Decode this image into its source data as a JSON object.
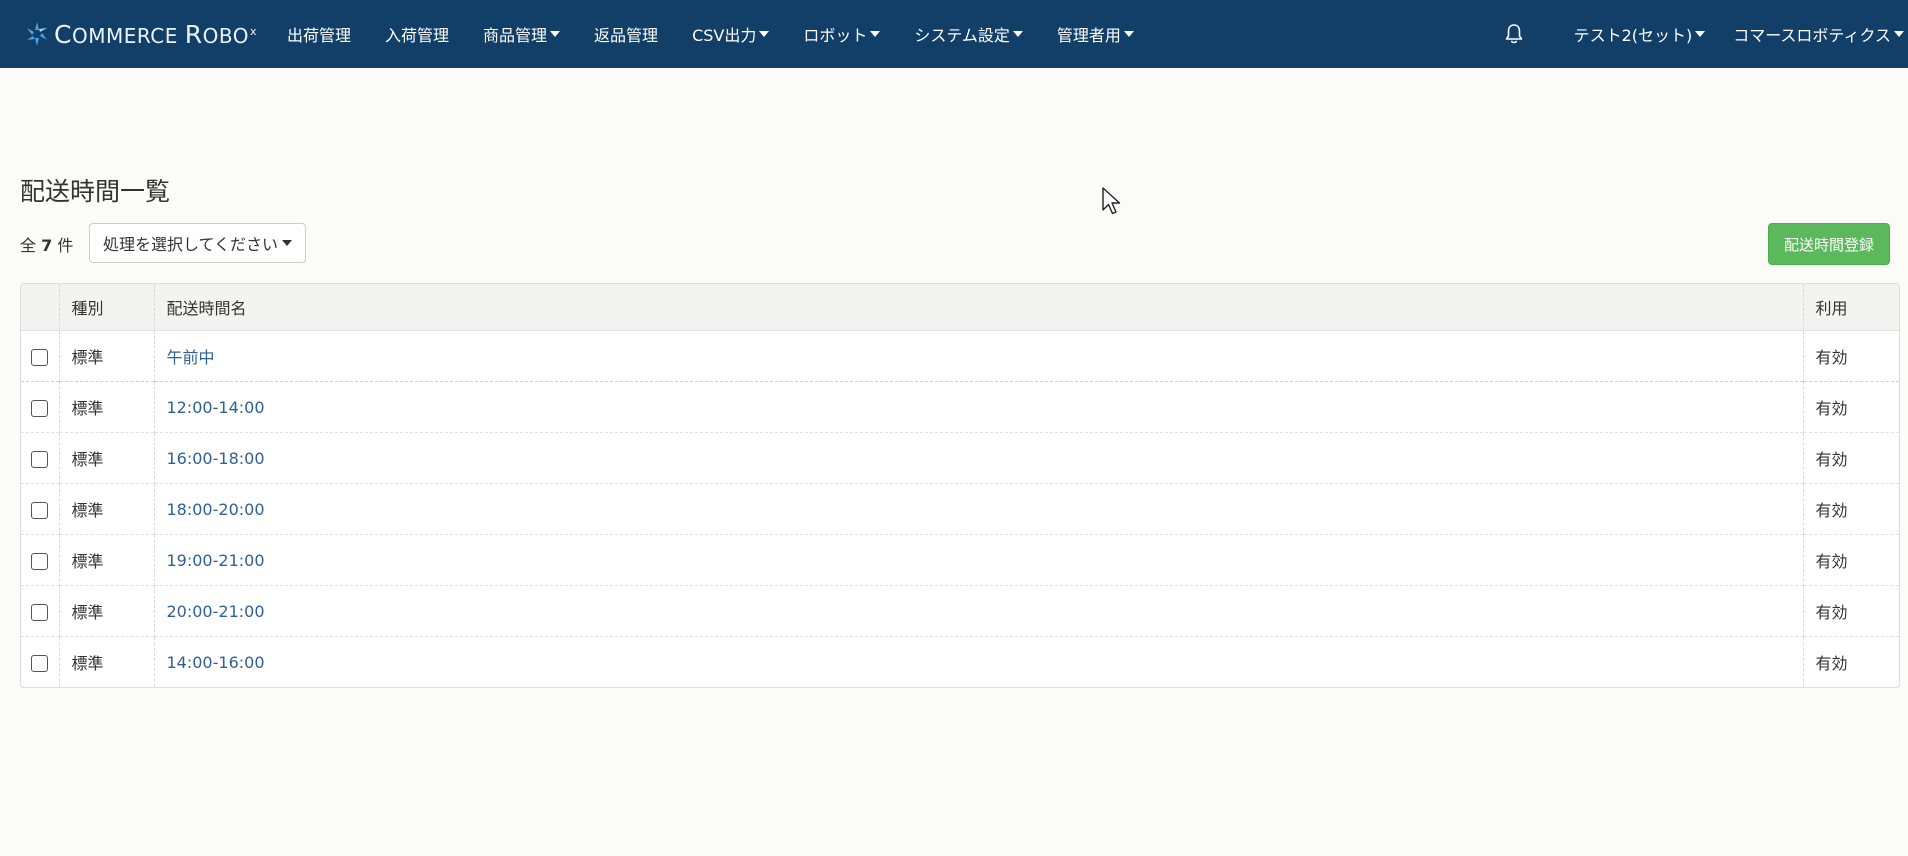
{
  "brand": {
    "first_letter": "C",
    "part1": "OMMERCE ",
    "second_letter": "R",
    "part2": "OBO",
    "sup": "x"
  },
  "nav": {
    "items": [
      {
        "label": "出荷管理",
        "dropdown": false
      },
      {
        "label": "入荷管理",
        "dropdown": false
      },
      {
        "label": "商品管理",
        "dropdown": true
      },
      {
        "label": "返品管理",
        "dropdown": false
      },
      {
        "label": "CSV出力",
        "dropdown": true
      },
      {
        "label": "ロボット",
        "dropdown": true
      },
      {
        "label": "システム設定",
        "dropdown": true
      },
      {
        "label": "管理者用",
        "dropdown": true
      }
    ],
    "bell_icon": "bell-icon",
    "account": "テスト2(セット)",
    "company": "コマースロボティクス"
  },
  "page": {
    "title": "配送時間一覧"
  },
  "toolbar": {
    "count_prefix": "全",
    "count_value": "7",
    "count_suffix": "件",
    "action_select": "処理を選択してください",
    "register_button": "配送時間登録"
  },
  "table": {
    "headers": {
      "kind": "種別",
      "name": "配送時間名",
      "usage": "利用"
    },
    "rows": [
      {
        "kind": "標準",
        "name": "午前中",
        "usage": "有効"
      },
      {
        "kind": "標準",
        "name": "12:00-14:00",
        "usage": "有効"
      },
      {
        "kind": "標準",
        "name": "16:00-18:00",
        "usage": "有効"
      },
      {
        "kind": "標準",
        "name": "18:00-20:00",
        "usage": "有効"
      },
      {
        "kind": "標準",
        "name": "19:00-21:00",
        "usage": "有効"
      },
      {
        "kind": "標準",
        "name": "20:00-21:00",
        "usage": "有効"
      },
      {
        "kind": "標準",
        "name": "14:00-16:00",
        "usage": "有効"
      }
    ]
  },
  "colors": {
    "navbar": "#123f68",
    "link": "#2f6096",
    "success": "#5cb85c",
    "background": "#fbfbf8"
  }
}
